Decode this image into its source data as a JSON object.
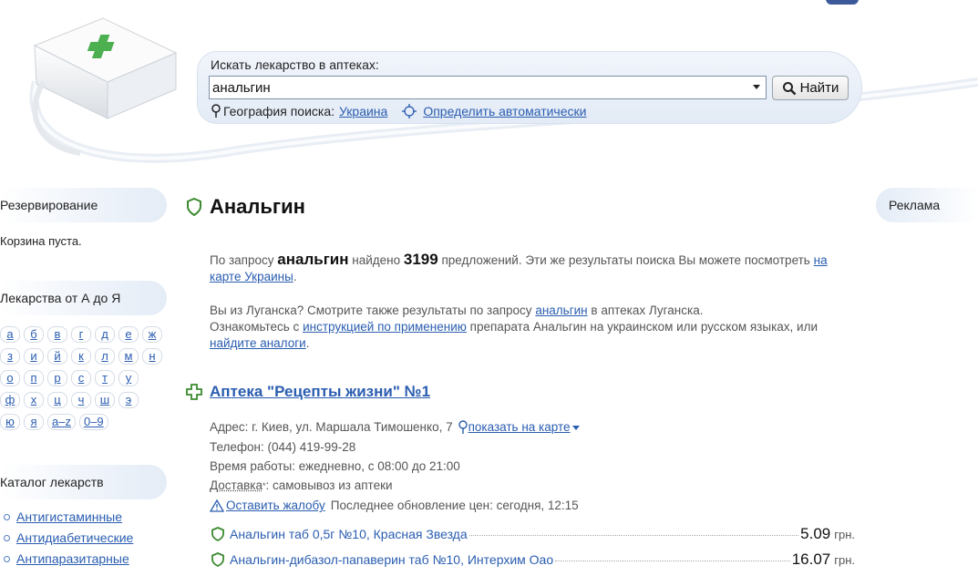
{
  "search": {
    "label": "Искать лекарство в аптеках:",
    "value": "анальгин",
    "button": "Найти",
    "geo_label": "География поиска:",
    "geo_value": "Украина",
    "auto_detect": "Определить автоматически"
  },
  "sidebar": {
    "reservation_title": "Резервирование",
    "cart_empty": "Корзина пуста.",
    "az_title": "Лекарства от А до Я",
    "letters": [
      [
        "а",
        "б",
        "в",
        "г",
        "д",
        "е",
        "ж"
      ],
      [
        "з",
        "и",
        "й",
        "к",
        "л",
        "м",
        "н"
      ],
      [
        "о",
        "п",
        "р",
        "с",
        "т",
        "у"
      ],
      [
        "ф",
        "х",
        "ц",
        "ч",
        "ш",
        "э"
      ],
      [
        "ю",
        "я",
        "a–z",
        "0–9"
      ]
    ],
    "catalog_title": "Каталог лекарств",
    "catalog_items": [
      "Антигистаминные",
      "Антидиабетические",
      "Антипаразитарные"
    ]
  },
  "right": {
    "ad_title": "Реклама"
  },
  "main": {
    "title": "Анальгин",
    "p1": {
      "pre": "По запросу",
      "query": "анальгин",
      "mid": "найдено",
      "count": "3199",
      "post": "предложений. Эти же результаты поиска Вы можете посмотреть",
      "link": "на карте Украины",
      "end": "."
    },
    "p2": {
      "pre": "Вы из Луганска? Смотрите также результаты по запросу",
      "link": "анальгин",
      "post": "в аптеках Луганска."
    },
    "p3": {
      "pre": "Ознакомьтесь с",
      "link1": "инструкцией по применению",
      "mid": "препарата Анальгин на украинском или русском языках, или",
      "link2": "найдите аналоги",
      "end": "."
    }
  },
  "pharmacy": {
    "name": "Аптека \"Рецепты жизни\" №1",
    "address": "Адрес: г. Киев, ул. Маршала Тимошенко, 7",
    "show_map": "показать на карте",
    "phone": "Телефон: (044) 419-99-28",
    "hours": "Время работы: ежедневно, с 08:00 до 21:00",
    "delivery_label": "Доставка",
    "delivery_star": "*",
    "delivery_value": ": самовывоз из аптеки",
    "complain": "Оставить жалобу",
    "last_update": "Последнее обновление цен: сегодня, 12:15",
    "products": [
      {
        "name": "Анальгин таб 0,5г №10, Красная Звезда",
        "price": "5.09",
        "currency": "грн."
      },
      {
        "name": "Анальгин-дибазол-папаверин таб №10, Интерхим Оао",
        "price": "16.07",
        "currency": "грн."
      }
    ]
  },
  "colors": {
    "accent": "#2a5db0",
    "green": "#3a8a2e",
    "panel": "#e8eff8"
  }
}
